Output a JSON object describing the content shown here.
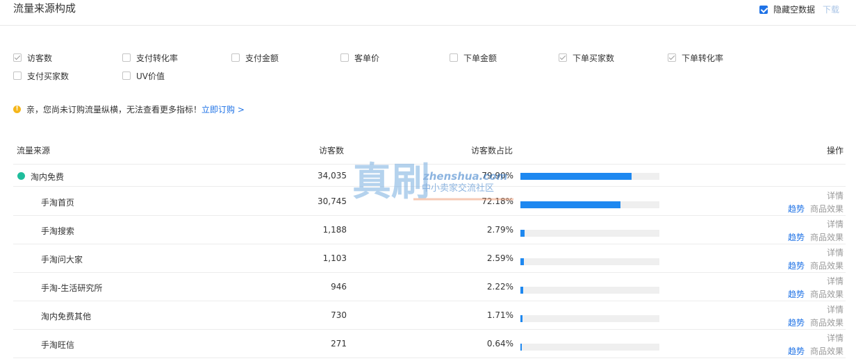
{
  "header": {
    "title": "流量来源构成",
    "hide_empty_label": "隐藏空数据",
    "hide_empty_checked": true,
    "download_label": "下载"
  },
  "metrics": [
    {
      "label": "访客数",
      "state": "checked-gray"
    },
    {
      "label": "支付转化率",
      "state": "unchecked"
    },
    {
      "label": "支付金额",
      "state": "unchecked"
    },
    {
      "label": "客单价",
      "state": "unchecked"
    },
    {
      "label": "下单金额",
      "state": "unchecked"
    },
    {
      "label": "下单买家数",
      "state": "checked-gray"
    },
    {
      "label": "下单转化率",
      "state": "checked-gray"
    },
    {
      "label": "支付买家数",
      "state": "unchecked"
    },
    {
      "label": "UV价值",
      "state": "unchecked"
    }
  ],
  "notice": {
    "text": "亲，您尚未订购流量纵横，无法查看更多指标！",
    "link": "立即订购 >"
  },
  "table": {
    "columns": {
      "source": "流量来源",
      "visitors": "访客数",
      "ratio": "访客数占比",
      "ops": "操作"
    },
    "parent": {
      "name": "淘内免费",
      "visitors": "34,035",
      "ratio": "79.90%",
      "ratio_value": 0.799
    },
    "rows": [
      {
        "name": "手淘首页",
        "visitors": "30,745",
        "ratio": "72.18%",
        "ratio_value": 0.7218
      },
      {
        "name": "手淘搜索",
        "visitors": "1,188",
        "ratio": "2.79%",
        "ratio_value": 0.0279
      },
      {
        "name": "手淘问大家",
        "visitors": "1,103",
        "ratio": "2.59%",
        "ratio_value": 0.0259
      },
      {
        "name": "手淘-生活研究所",
        "visitors": "946",
        "ratio": "2.22%",
        "ratio_value": 0.0222
      },
      {
        "name": "淘内免费其他",
        "visitors": "730",
        "ratio": "1.71%",
        "ratio_value": 0.0171
      },
      {
        "name": "手淘旺信",
        "visitors": "271",
        "ratio": "0.64%",
        "ratio_value": 0.0064
      }
    ],
    "op_detail": "详情",
    "op_trend": "趋势",
    "op_goods": "商品效果"
  },
  "watermark": {
    "big_text": "真刷",
    "domain": "zhenshua.com",
    "slogan": "中小卖家交流社区"
  }
}
